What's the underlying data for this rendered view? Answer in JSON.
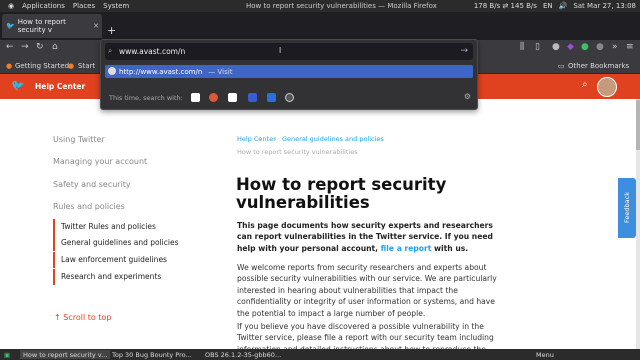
{
  "os": {
    "menu": [
      "Applications",
      "Places",
      "System"
    ],
    "window_title": "How to report security vulnerabilities — Mozilla Firefox",
    "net_speed": "178 B/s ⇄ 145 B/s",
    "lang": "EN",
    "clock": "Sat Mar 27, 13:08"
  },
  "browser": {
    "tab_title": "How to report security v",
    "new_tab": "+",
    "url_value": "www.avast.com/n",
    "suggestion_url": "http://www.avast.com/n",
    "suggestion_action": "Visit",
    "search_with": "This time, search with:",
    "bookmarks": [
      "Getting Started",
      "Start",
      "Other Bookmarks"
    ]
  },
  "twitter": {
    "help_center": "Help Center"
  },
  "sidebar": {
    "sections": [
      "Using Twitter",
      "Managing your account",
      "Safety and security",
      "Rules and policies"
    ],
    "sub_items": [
      "Twitter Rules and policies",
      "General guidelines and policies",
      "Law enforcement guidelines",
      "Research and experiments"
    ],
    "scroll_to_top": "Scroll to top"
  },
  "content": {
    "breadcrumb_1": "Help Center",
    "breadcrumb_2": "General guidelines and policies",
    "breadcrumb_3": "How to report security vulnerabilities",
    "title": "How to report security vulnerabilities",
    "intro_a": "This page documents how security experts and researchers can report vulnerabilities in the Twitter service. If you need help with your personal account, ",
    "intro_link": "file a report",
    "intro_b": " with us.",
    "para1": "We welcome reports from security researchers and experts about possible security vulnerabilities with our service. We are particularly interested in hearing about vulnerabilities that impact the confidentiality or integrity of user information or systems, and have the potential to impact a large number of people.",
    "para2": "If you believe you have discovered a possible vulnerability in the Twitter service, please file a report with our security team including information and detailed instructions about how to reproduce the issue. You can file"
  },
  "feedback": "Feedback",
  "taskbar": {
    "tasks": [
      "How to report security v...",
      "Top 30 Bug Bounty Pro...",
      "OBS 26.1.2-35-gbb60..."
    ],
    "menu": "Menu"
  },
  "colors": {
    "twitter_bar": "#e0421f",
    "link": "#1da1f2",
    "suggestion_highlight": "#3f66c7"
  }
}
